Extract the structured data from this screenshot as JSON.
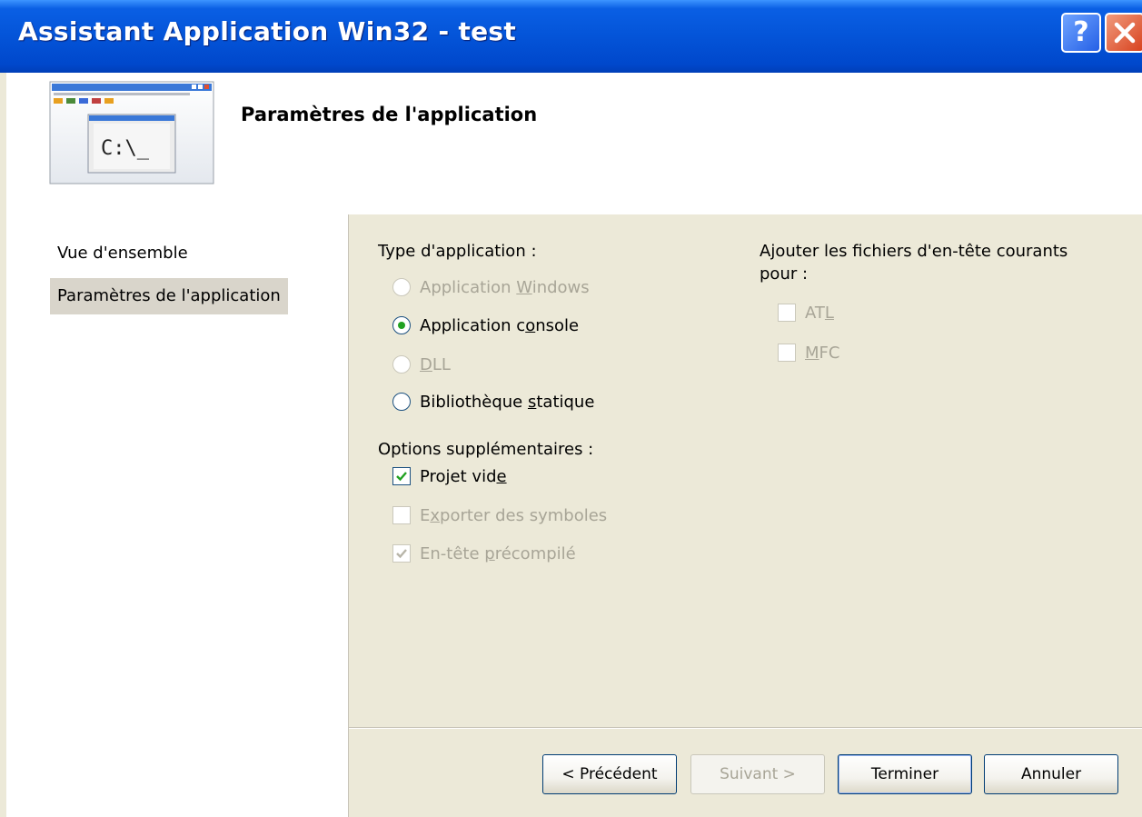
{
  "window": {
    "title": "Assistant Application Win32 - test",
    "help_glyph": "?",
    "close_icon": "close-icon"
  },
  "header": {
    "title": "Paramètres de l'application",
    "icon": "console-app-icon",
    "icon_text": "C:\\_"
  },
  "nav": {
    "items": [
      {
        "label": "Vue d'ensemble",
        "selected": false
      },
      {
        "label": "Paramètres de l'application",
        "selected": true
      }
    ]
  },
  "app_type": {
    "label": "Type d'application :",
    "options": [
      {
        "pre": "Application ",
        "ul": "W",
        "post": "indows",
        "checked": false,
        "enabled": false
      },
      {
        "pre": "Application c",
        "ul": "o",
        "post": "nsole",
        "checked": true,
        "enabled": true
      },
      {
        "pre": "",
        "ul": "D",
        "post": "LL",
        "checked": false,
        "enabled": false
      },
      {
        "pre": "Bibliothèque ",
        "ul": "s",
        "post": "tatique",
        "checked": false,
        "enabled": true
      }
    ]
  },
  "extra_options": {
    "label": "Options supplémentaires :",
    "options": [
      {
        "pre": "Projet vid",
        "ul": "e",
        "post": "",
        "checked": true,
        "enabled": true
      },
      {
        "pre": "E",
        "ul": "x",
        "post": "porter des symboles",
        "checked": false,
        "enabled": false
      },
      {
        "pre": "En-tête ",
        "ul": "p",
        "post": "récompilé",
        "checked": true,
        "enabled": false
      }
    ]
  },
  "headers_group": {
    "label_line1": "Ajouter les fichiers d'en-tête courants",
    "label_line2": "pour :",
    "options": [
      {
        "pre": "AT",
        "ul": "L",
        "post": "",
        "checked": false,
        "enabled": false
      },
      {
        "pre": "",
        "ul": "M",
        "post": "FC",
        "checked": false,
        "enabled": false
      }
    ]
  },
  "buttons": {
    "previous": "< Précédent",
    "next": "Suivant >",
    "finish": "Terminer",
    "cancel": "Annuler"
  },
  "colors": {
    "titlebar": "#0454d8",
    "radio_dot": "#21a121",
    "checkmark": "#21a121",
    "disabled_text": "#a8a597"
  }
}
